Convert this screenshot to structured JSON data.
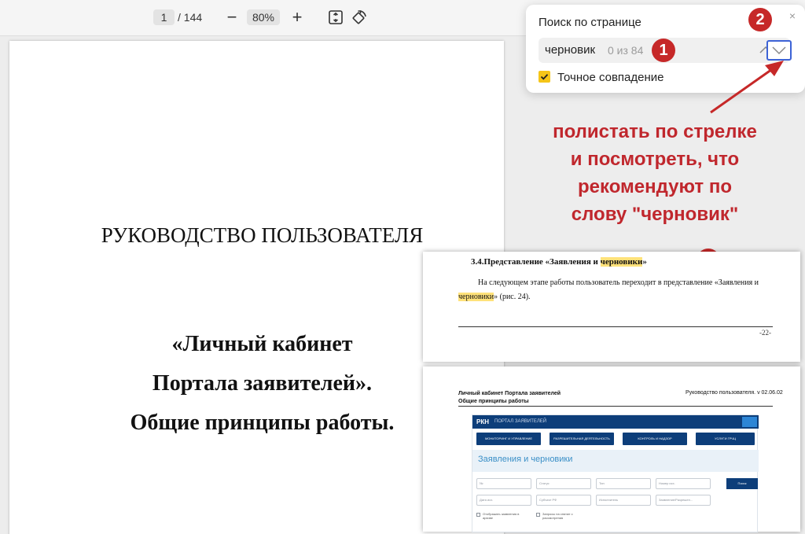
{
  "toolbar": {
    "current_page": "1",
    "total_pages": "/ 144",
    "zoom_out": "−",
    "zoom_value": "80%",
    "zoom_in": "+",
    "icons": [
      "fit-page-icon",
      "rotate-icon"
    ]
  },
  "document": {
    "title": "РУКОВОДСТВО ПОЛЬЗОВАТЕЛЯ",
    "subtitle_lines": [
      "«Личный кабинет",
      "Портала заявителей».",
      "Общие принципы работы."
    ]
  },
  "search": {
    "title": "Поиск по странице",
    "close": "×",
    "query": "черновик",
    "count": "0 из 84",
    "exact_match_label": "Точное совпадение",
    "exact_match_checked": true
  },
  "badges": [
    "1",
    "2",
    "3"
  ],
  "annotation": {
    "lines": [
      "полистать по стрелке",
      "и посмотреть, что",
      "рекомендуют по",
      "слову \"черновик\""
    ],
    "color": "#c0272d"
  },
  "excerpt1": {
    "heading_prefix": "3.4.Представление «Заявления и ",
    "heading_highlight": "черновики",
    "heading_suffix": "»",
    "p1": "На следующем этапе работы пользователь переходит в представление «Заявления и",
    "p2_highlight": "черновики",
    "p2_suffix": "» (рис. 24).",
    "page_number": "-22-"
  },
  "excerpt2": {
    "header_left_1": "Личный кабинет Портала заявителей",
    "header_left_2": "Общие принципы работы",
    "header_right": "Руководство пользователя. v 02.06.02",
    "portal": {
      "logo": "РКН",
      "name": "ПОРТАЛ ЗАЯВИТЕЛЕЙ",
      "tabs": [
        "МОНИТОРИНГ И УПРАВЛЕНИЕ",
        "РАЗРЕШИТЕЛЬНАЯ ДЕЯТЕЛЬНОСТЬ",
        "КОНТРОЛЬ И НАДЗОР",
        "УСЛУГИ ГРЧЦ"
      ],
      "section_title": "Заявления и черновики",
      "fields_row1": [
        "№",
        "Статус",
        "Тип",
        "Номер исх."
      ],
      "search_button": "Поиск",
      "fields_row2": [
        "Дата исх.",
        "Субъект РФ",
        "Исполнитель",
        "Заявление/Разрешен..."
      ],
      "checkbox1": "Отображать заявления в архиве",
      "checkbox2": "Запросы на снятие с рассмотрения"
    }
  },
  "colors": {
    "badge": "#c62828",
    "arrow": "#c62828",
    "highlight": "#ffe27a",
    "checkbox": "#f5c518",
    "portal_navy": "#0d3e7a",
    "portal_accent": "#3a8fc7",
    "nav_down_border": "#3d63d6"
  }
}
